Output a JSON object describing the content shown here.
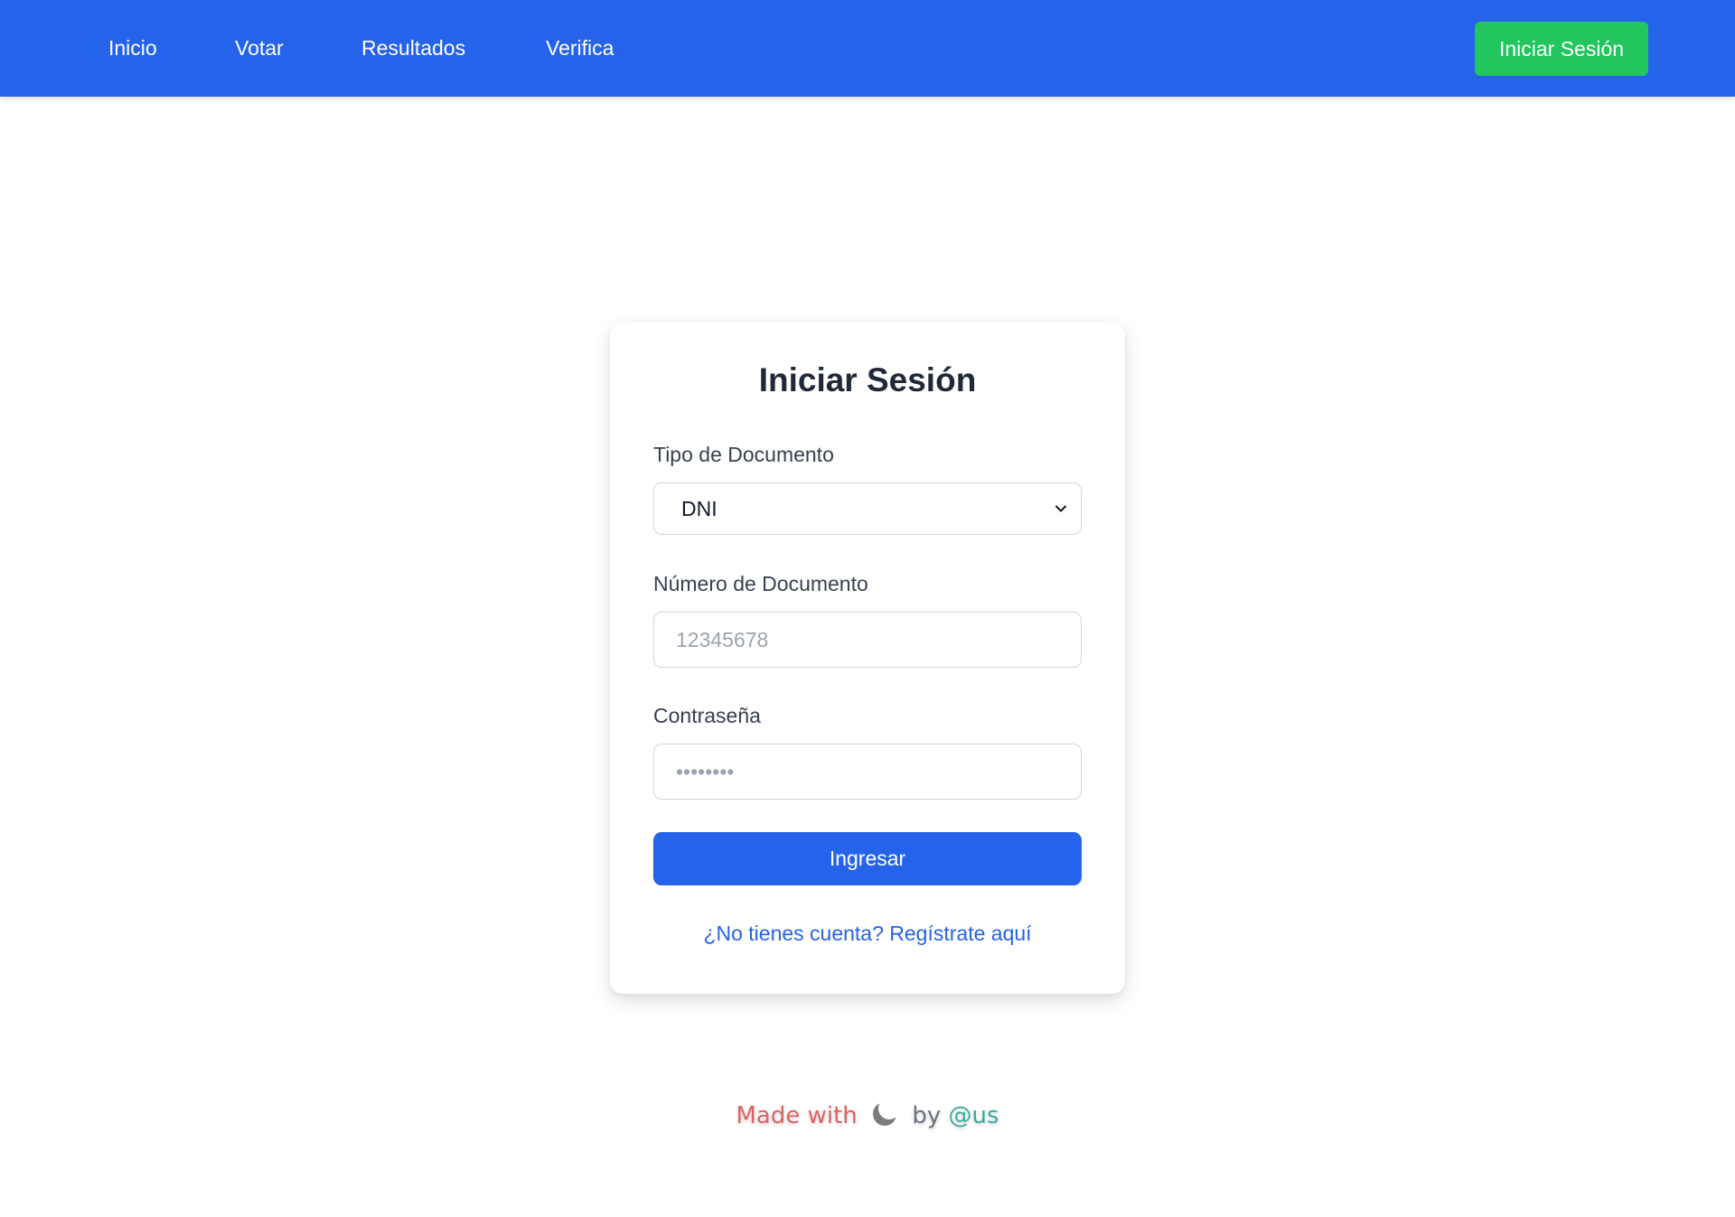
{
  "nav": {
    "links": [
      "Inicio",
      "Votar",
      "Resultados",
      "Verifica"
    ],
    "login_button": "Iniciar Sesión",
    "colors": {
      "bar": "#2563eb",
      "login": "#22c55e"
    }
  },
  "login_form": {
    "title": "Iniciar Sesión",
    "document_type": {
      "label": "Tipo de Documento",
      "selected": "DNI"
    },
    "document_number": {
      "label": "Número de Documento",
      "placeholder": "12345678"
    },
    "password": {
      "label": "Contraseña",
      "placeholder": "••••••••"
    },
    "submit_label": "Ingresar",
    "register_link": "¿No tienes cuenta? Regístrate aquí"
  },
  "footer": {
    "made_with": "Made with",
    "icon": "moon-icon",
    "by": "by",
    "handle": "@us"
  }
}
